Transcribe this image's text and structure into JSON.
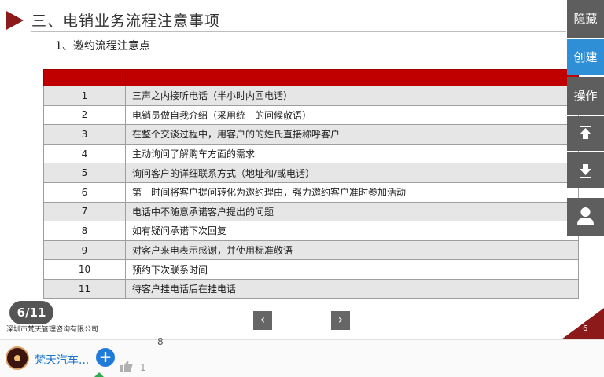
{
  "slide": {
    "title": "三、电销业务流程注意事项",
    "subtitle": "1、邀约流程注意点",
    "rows": [
      {
        "num": "1",
        "text": "三声之内接听电话（半小时内回电话）"
      },
      {
        "num": "2",
        "text": "电销员做自我介绍（采用统一的问候敬语）"
      },
      {
        "num": "3",
        "text": "在整个交谈过程中，用客户的的姓氏直接称呼客户"
      },
      {
        "num": "4",
        "text": "主动询问了解购车方面的需求"
      },
      {
        "num": "5",
        "text": "询问客户的详细联系方式（地址和/或电话）"
      },
      {
        "num": "6",
        "text": "第一时间将客户提问转化为邀约理由，强力邀约客户准时参加活动"
      },
      {
        "num": "7",
        "text": "电话中不随意承诺客户提出的问题"
      },
      {
        "num": "8",
        "text": "如有疑问承诺下次回复"
      },
      {
        "num": "9",
        "text": "对客户来电表示感谢，并使用标准敬语"
      },
      {
        "num": "10",
        "text": "预约下次联系时间"
      },
      {
        "num": "11",
        "text": "待客户挂电话后在挂电话"
      }
    ],
    "page_indicator": "6/11",
    "company": "深圳市梵天管理咨询有限公司",
    "corner_page": "6",
    "prev_symbol": "‹",
    "next_symbol": "›",
    "accent_color": "#c00000"
  },
  "side_panel": {
    "hide": "隐藏",
    "create": "创建",
    "operate": "操作",
    "top_icon": "top-arrow-icon",
    "bottom_icon": "bottom-arrow-icon",
    "user_icon": "user-icon"
  },
  "bottom_bar": {
    "channel_name": "梵天汽车...",
    "follow_symbol": "+",
    "like_count": "1",
    "stray_digit": "8"
  }
}
